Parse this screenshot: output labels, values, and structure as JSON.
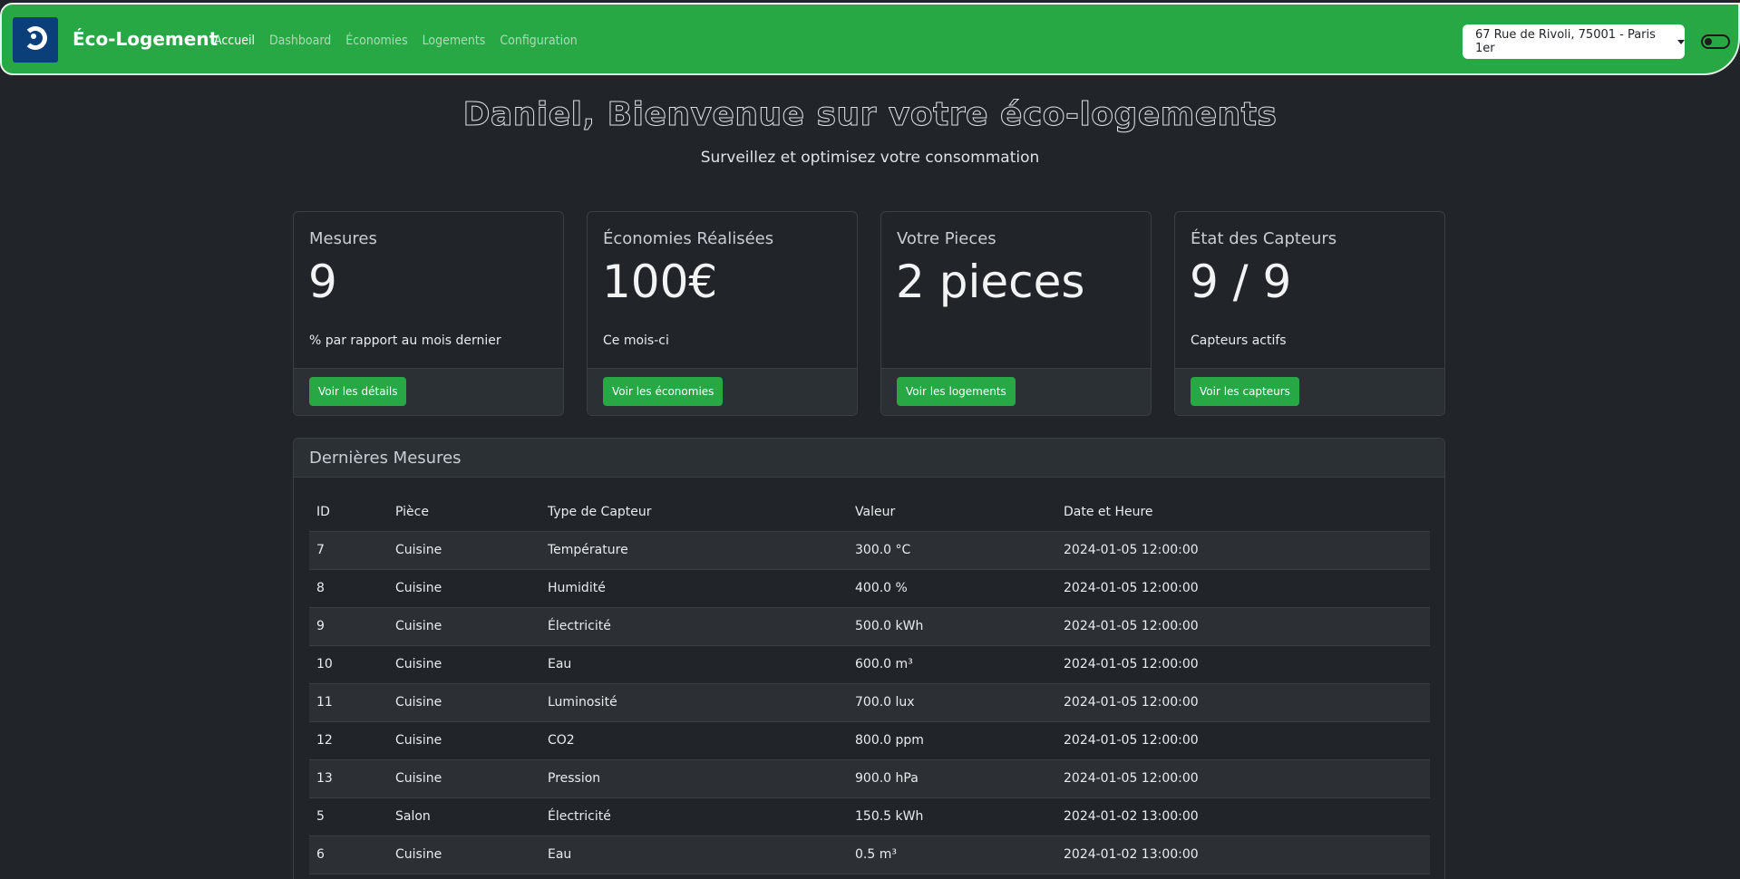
{
  "nav": {
    "brand": "Éco-Logement",
    "links": [
      "Accueil",
      "Dashboard",
      "Économies",
      "Logements",
      "Configuration"
    ],
    "address": "67 Rue de Rivoli, 75001 - Paris 1er"
  },
  "hero": {
    "title": "Daniel, Bienvenue sur votre éco-logements",
    "subtitle": "Surveillez et optimisez votre consommation"
  },
  "cards": [
    {
      "title": "Mesures",
      "value": "9",
      "text": "% par rapport au mois dernier",
      "button": "Voir les détails"
    },
    {
      "title": "Économies Réalisées",
      "value": "100€",
      "text": "Ce mois-ci",
      "button": "Voir les économies"
    },
    {
      "title": "Votre Pieces",
      "value": "2 pieces",
      "text": "",
      "button": "Voir les logements"
    },
    {
      "title": "État des Capteurs",
      "value": "9 / 9",
      "text": "Capteurs actifs",
      "button": "Voir les capteurs"
    }
  ],
  "table": {
    "title": "Dernières Mesures",
    "columns": [
      "ID",
      "Pièce",
      "Type de Capteur",
      "Valeur",
      "Date et Heure"
    ],
    "rows": [
      [
        "7",
        "Cuisine",
        "Température",
        "300.0 °C",
        "2024-01-05 12:00:00"
      ],
      [
        "8",
        "Cuisine",
        "Humidité",
        "400.0 %",
        "2024-01-05 12:00:00"
      ],
      [
        "9",
        "Cuisine",
        "Électricité",
        "500.0 kWh",
        "2024-01-05 12:00:00"
      ],
      [
        "10",
        "Cuisine",
        "Eau",
        "600.0 m³",
        "2024-01-05 12:00:00"
      ],
      [
        "11",
        "Cuisine",
        "Luminosité",
        "700.0 lux",
        "2024-01-05 12:00:00"
      ],
      [
        "12",
        "Cuisine",
        "CO2",
        "800.0 ppm",
        "2024-01-05 12:00:00"
      ],
      [
        "13",
        "Cuisine",
        "Pression",
        "900.0 hPa",
        "2024-01-05 12:00:00"
      ],
      [
        "5",
        "Salon",
        "Électricité",
        "150.5 kWh",
        "2024-01-02 13:00:00"
      ],
      [
        "6",
        "Cuisine",
        "Eau",
        "0.5 m³",
        "2024-01-02 13:00:00"
      ]
    ]
  }
}
